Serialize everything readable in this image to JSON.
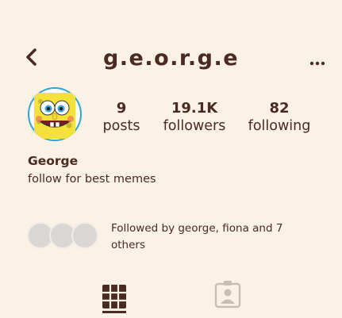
{
  "header": {
    "username": "g.e.o.r.g.e",
    "back_icon": "chevron-left-icon",
    "more_icon": "more-horizontal-icon"
  },
  "profile": {
    "avatar": "spongebob-avatar",
    "display_name": "George",
    "bio": "follow for best memes"
  },
  "stats": {
    "posts": {
      "value": "9",
      "label": "posts"
    },
    "followers": {
      "value": "19.1K",
      "label": "followers"
    },
    "following": {
      "value": "82",
      "label": "following"
    }
  },
  "mutuals": {
    "text": "Followed by george, fiona and 7 others"
  },
  "tabs": [
    {
      "icon": "grid-icon",
      "active": true
    },
    {
      "icon": "tagged-person-icon",
      "active": false
    }
  ],
  "colors": {
    "background": "#fbf1e5",
    "text": "#4a2a22",
    "inactive_icon": "#c9bdb6"
  }
}
